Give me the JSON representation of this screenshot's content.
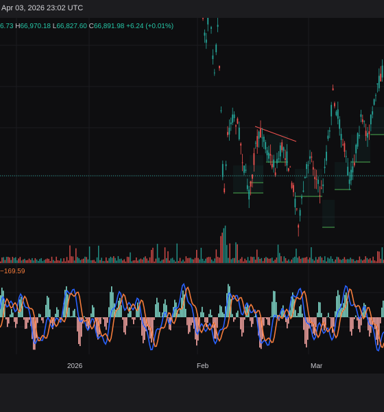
{
  "header": {
    "datetime": "Apr 03, 2026 23:02 UTC"
  },
  "ohlc": {
    "open_partial": "6.73",
    "high_label": "H",
    "high": "66,970.18",
    "low_label": "L",
    "low": "66,827.60",
    "close_label": "C",
    "close": "66,891.98",
    "change": "+6.24 (+0.01%)"
  },
  "indicator": {
    "macd_value": "−169.59"
  },
  "x_axis": {
    "labels": [
      "2026",
      "Feb",
      "Mar"
    ]
  },
  "colors": {
    "up": "#26a69a",
    "down": "#ef5350",
    "macd_line": "#2962ff",
    "signal_line": "#f57c3c",
    "hist_up": "#7fd8c9",
    "hist_down": "#f4a3a1"
  }
}
